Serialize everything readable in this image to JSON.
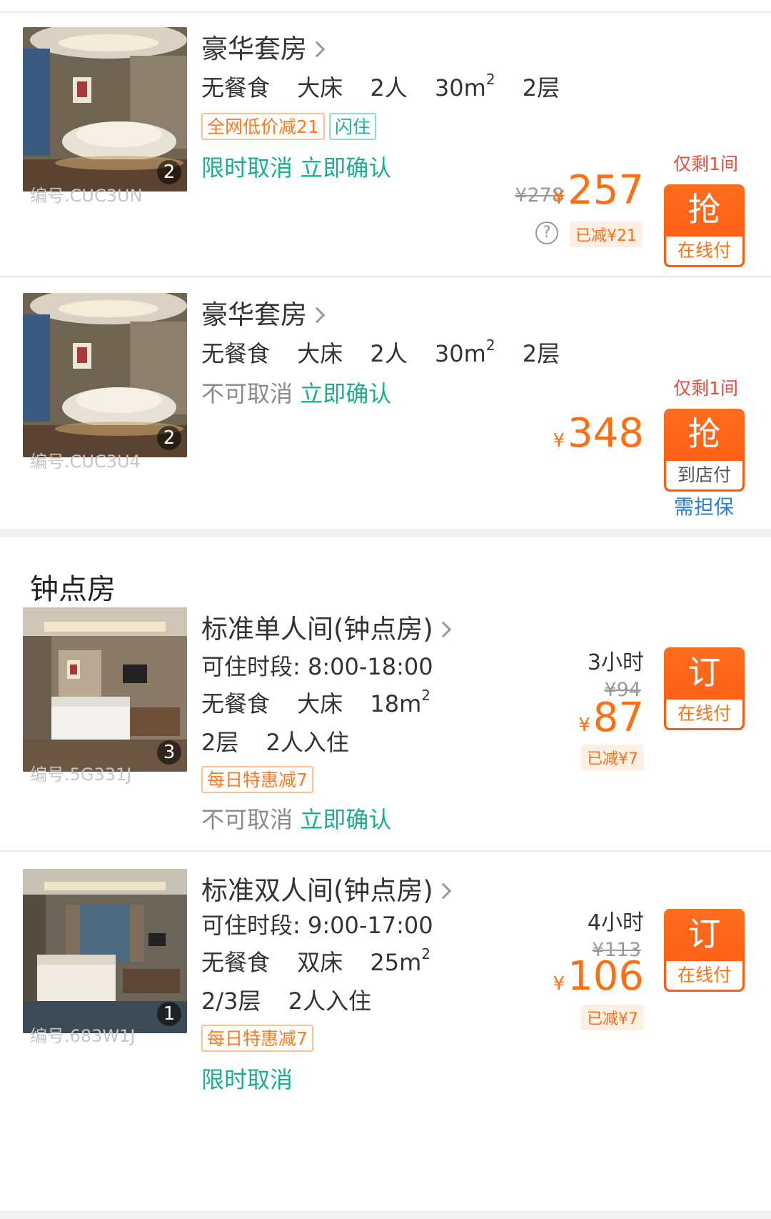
{
  "rooms": [
    {
      "image_count": "2",
      "code": "编号.CUC3UN",
      "title": "豪华套房",
      "meta": [
        "无餐食",
        "大床",
        "2人",
        "30m",
        "2层"
      ],
      "area_sup": "2",
      "tags": [
        {
          "text": "全网低价减21",
          "style": "orange"
        },
        {
          "text": "闪住",
          "style": "teal"
        }
      ],
      "policy_cancel": "限时取消",
      "policy_confirm": "立即确认",
      "stock": "仅剩1间",
      "original_price": "¥278",
      "currency": "¥",
      "price": "257",
      "saved": "已减¥21",
      "help_icon": "?",
      "button_main": "抢",
      "button_sub": "在线付"
    },
    {
      "image_count": "2",
      "code": "编号.CUC3U4",
      "title": "豪华套房",
      "meta": [
        "无餐食",
        "大床",
        "2人",
        "30m",
        "2层"
      ],
      "area_sup": "2",
      "policy_cancel": "不可取消",
      "policy_confirm": "立即确认",
      "stock": "仅剩1间",
      "currency": "¥",
      "price": "348",
      "button_main": "抢",
      "button_sub": "到店付",
      "guarantee": "需担保"
    }
  ],
  "hourly_section_title": "钟点房",
  "hourly_rooms": [
    {
      "image_count": "3",
      "code": "编号.5G331J",
      "title": "标准单人间(钟点房)",
      "time_slot": "可住时段: 8:00-18:00",
      "meta": [
        "无餐食",
        "大床",
        "18m"
      ],
      "area_sup": "2",
      "floor_guests": [
        "2层",
        "2人入住"
      ],
      "tag": "每日特惠减7",
      "policy_cancel": "不可取消",
      "policy_confirm": "立即确认",
      "hours": "3小时",
      "original_price": "¥94",
      "currency": "¥",
      "price": "87",
      "saved": "已减¥7",
      "button_main": "订",
      "button_sub": "在线付"
    },
    {
      "image_count": "1",
      "code": "编号.683W1J",
      "title": "标准双人间(钟点房)",
      "time_slot": "可住时段: 9:00-17:00",
      "meta": [
        "无餐食",
        "双床",
        "25m"
      ],
      "area_sup": "2",
      "floor_guests": [
        "2/3层",
        "2人入住"
      ],
      "tag": "每日特惠减7",
      "policy_cancel": "限时取消",
      "hours": "4小时",
      "original_price": "¥113",
      "currency": "¥",
      "price": "106",
      "saved": "已减¥7",
      "button_main": "订",
      "button_sub": "在线付"
    }
  ],
  "colors": {
    "accent_orange": "#ff6f12",
    "policy_green": "#1aaf8c",
    "stock_red": "#e54c3c",
    "link_blue": "#2b7fd6"
  }
}
